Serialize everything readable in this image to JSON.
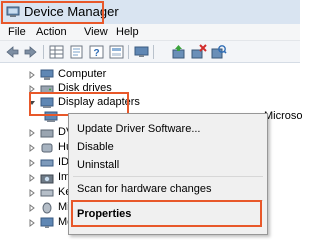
{
  "window": {
    "title": "Device Manager"
  },
  "menu": [
    "File",
    "Action",
    "View",
    "Help"
  ],
  "toolbar": {
    "buttons": [
      "back-icon",
      "forward-icon",
      "properties-grid-icon",
      "help-icon",
      "properties-sheet-icon",
      "monitor-icon",
      "update-driver-icon",
      "uninstall-icon",
      "scan-hardware-icon"
    ]
  },
  "tree": {
    "items": [
      {
        "label": "Computer",
        "expanded": false
      },
      {
        "label": "Disk drives",
        "expanded": false
      },
      {
        "label": "Display adapters",
        "expanded": true
      },
      {
        "label": "DVD",
        "expanded": false
      },
      {
        "label": "Hum",
        "expanded": false
      },
      {
        "label": "IDE A",
        "expanded": false
      },
      {
        "label": "Imag",
        "expanded": false
      },
      {
        "label": "Keyb",
        "expanded": false
      },
      {
        "label": "Mice",
        "expanded": false
      },
      {
        "label": "Mon",
        "expanded": false
      }
    ],
    "child_adapter_text": "Microso"
  },
  "context_menu": {
    "items": [
      "Update Driver Software...",
      "Disable",
      "Uninstall",
      "Scan for hardware changes",
      "Properties"
    ]
  },
  "colors": {
    "highlight": "#e8582a",
    "titlebar": "#d9e4f1",
    "menu_bg": "#f0f0f0"
  }
}
